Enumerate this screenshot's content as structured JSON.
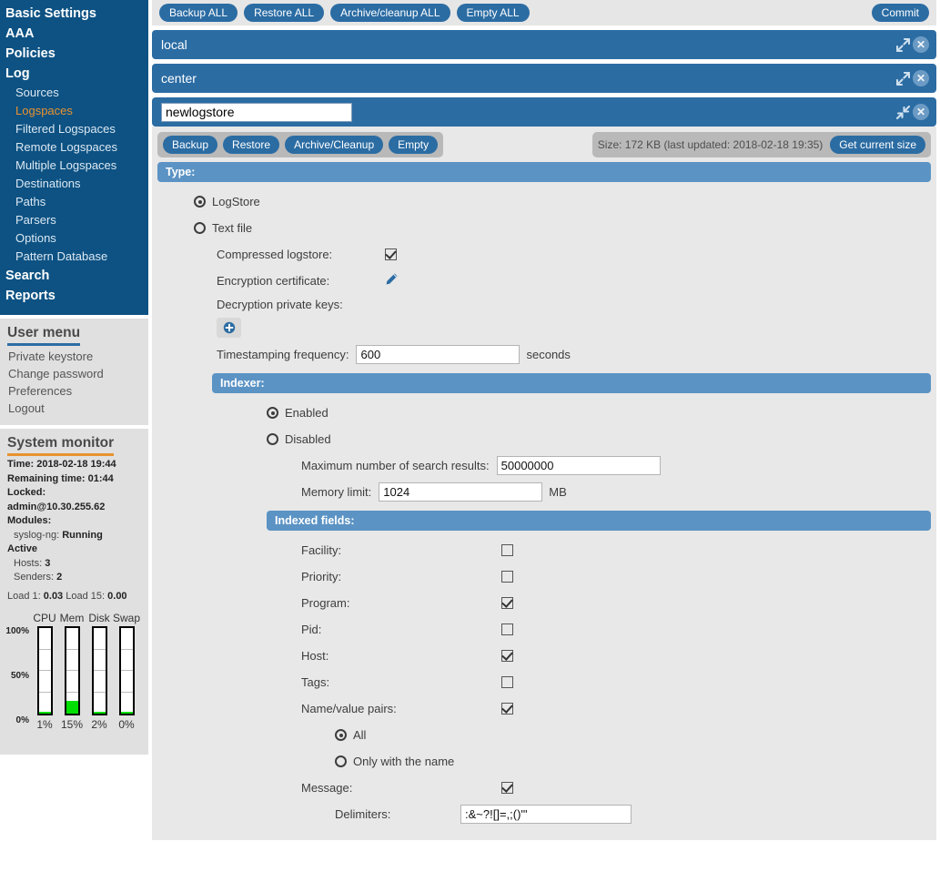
{
  "sidebar": {
    "nav": [
      {
        "label": "Basic Settings",
        "level": "top",
        "active": false
      },
      {
        "label": "AAA",
        "level": "top",
        "active": false
      },
      {
        "label": "Policies",
        "level": "top",
        "active": false
      },
      {
        "label": "Log",
        "level": "top",
        "active": false
      },
      {
        "label": "Sources",
        "level": "sub",
        "active": false
      },
      {
        "label": "Logspaces",
        "level": "sub",
        "active": true
      },
      {
        "label": "Filtered Logspaces",
        "level": "sub",
        "active": false
      },
      {
        "label": "Remote Logspaces",
        "level": "sub",
        "active": false
      },
      {
        "label": "Multiple Logspaces",
        "level": "sub",
        "active": false
      },
      {
        "label": "Destinations",
        "level": "sub",
        "active": false
      },
      {
        "label": "Paths",
        "level": "sub",
        "active": false
      },
      {
        "label": "Parsers",
        "level": "sub",
        "active": false
      },
      {
        "label": "Options",
        "level": "sub",
        "active": false
      },
      {
        "label": "Pattern Database",
        "level": "sub",
        "active": false
      },
      {
        "label": "Search",
        "level": "top",
        "active": false
      },
      {
        "label": "Reports",
        "level": "top",
        "active": false
      }
    ],
    "user_menu": {
      "title": "User menu",
      "items": [
        "Private keystore",
        "Change password",
        "Preferences",
        "Logout"
      ]
    },
    "system_monitor": {
      "title": "System monitor",
      "time_label": "Time:",
      "time_value": "2018-02-18 19:44",
      "remaining_label": "Remaining time:",
      "remaining_value": "01:44",
      "locked_label": "Locked:",
      "locked_value": "admin@10.30.255.62",
      "modules_label": "Modules:",
      "module_name": "syslog-ng:",
      "module_status": "Running",
      "active_label": "Active",
      "hosts_label": "Hosts:",
      "hosts_value": "3",
      "senders_label": "Senders:",
      "senders_value": "2",
      "load1_label": "Load 1:",
      "load1_value": "0.03",
      "load15_label": "Load 15:",
      "load15_value": "0.00",
      "gauges": {
        "scale": [
          "100%",
          "50%",
          "0%"
        ],
        "items": [
          {
            "name": "CPU",
            "value": 1,
            "display": "1%"
          },
          {
            "name": "Mem",
            "value": 15,
            "display": "15%"
          },
          {
            "name": "Disk",
            "value": 2,
            "display": "2%"
          },
          {
            "name": "Swap",
            "value": 0,
            "display": "0%"
          }
        ]
      }
    }
  },
  "toolbar": {
    "backup_all": "Backup ALL",
    "restore_all": "Restore ALL",
    "archive_cleanup_all": "Archive/cleanup ALL",
    "empty_all": "Empty ALL",
    "commit": "Commit"
  },
  "accordions": [
    {
      "title": "local",
      "expanded": false
    },
    {
      "title": "center",
      "expanded": false
    }
  ],
  "logstore": {
    "name_value": "newlogstore",
    "actions": {
      "backup": "Backup",
      "restore": "Restore",
      "archive_cleanup": "Archive/Cleanup",
      "empty": "Empty"
    },
    "size_text": "Size: 172 KB (last updated: 2018-02-18 19:35)",
    "get_current_size": "Get current size",
    "type_section": {
      "header": "Type:",
      "options": [
        {
          "label": "LogStore",
          "selected": true
        },
        {
          "label": "Text file",
          "selected": false
        }
      ],
      "compressed_label": "Compressed logstore:",
      "compressed_checked": true,
      "encryption_label": "Encryption certificate:",
      "decryption_label": "Decryption private keys:",
      "timestamp_label": "Timestamping frequency:",
      "timestamp_value": "600",
      "timestamp_unit": "seconds"
    },
    "indexer_section": {
      "header": "Indexer:",
      "options": [
        {
          "label": "Enabled",
          "selected": true
        },
        {
          "label": "Disabled",
          "selected": false
        }
      ],
      "max_results_label": "Maximum number of search results:",
      "max_results_value": "50000000",
      "memory_limit_label": "Memory limit:",
      "memory_limit_value": "1024",
      "memory_limit_unit": "MB",
      "indexed_fields": {
        "header": "Indexed fields:",
        "fields": [
          {
            "label": "Facility:",
            "checked": false
          },
          {
            "label": "Priority:",
            "checked": false
          },
          {
            "label": "Program:",
            "checked": true
          },
          {
            "label": "Pid:",
            "checked": false
          },
          {
            "label": "Host:",
            "checked": true
          },
          {
            "label": "Tags:",
            "checked": false
          }
        ],
        "nvp_label": "Name/value pairs:",
        "nvp_checked": true,
        "nvp_options": [
          {
            "label": "All",
            "selected": true
          },
          {
            "label": "Only with the name",
            "selected": false
          }
        ],
        "message_label": "Message:",
        "message_checked": true,
        "delimiters_label": "Delimiters:",
        "delimiters_value": ":&~?![]=,;()'\""
      }
    }
  },
  "colors": {
    "sidebar_bg": "#0d5283",
    "accent_blue": "#2b6ca3",
    "section_blue": "#5b93c4",
    "active_orange": "#e8922f",
    "gauge_green": "#00e000"
  }
}
